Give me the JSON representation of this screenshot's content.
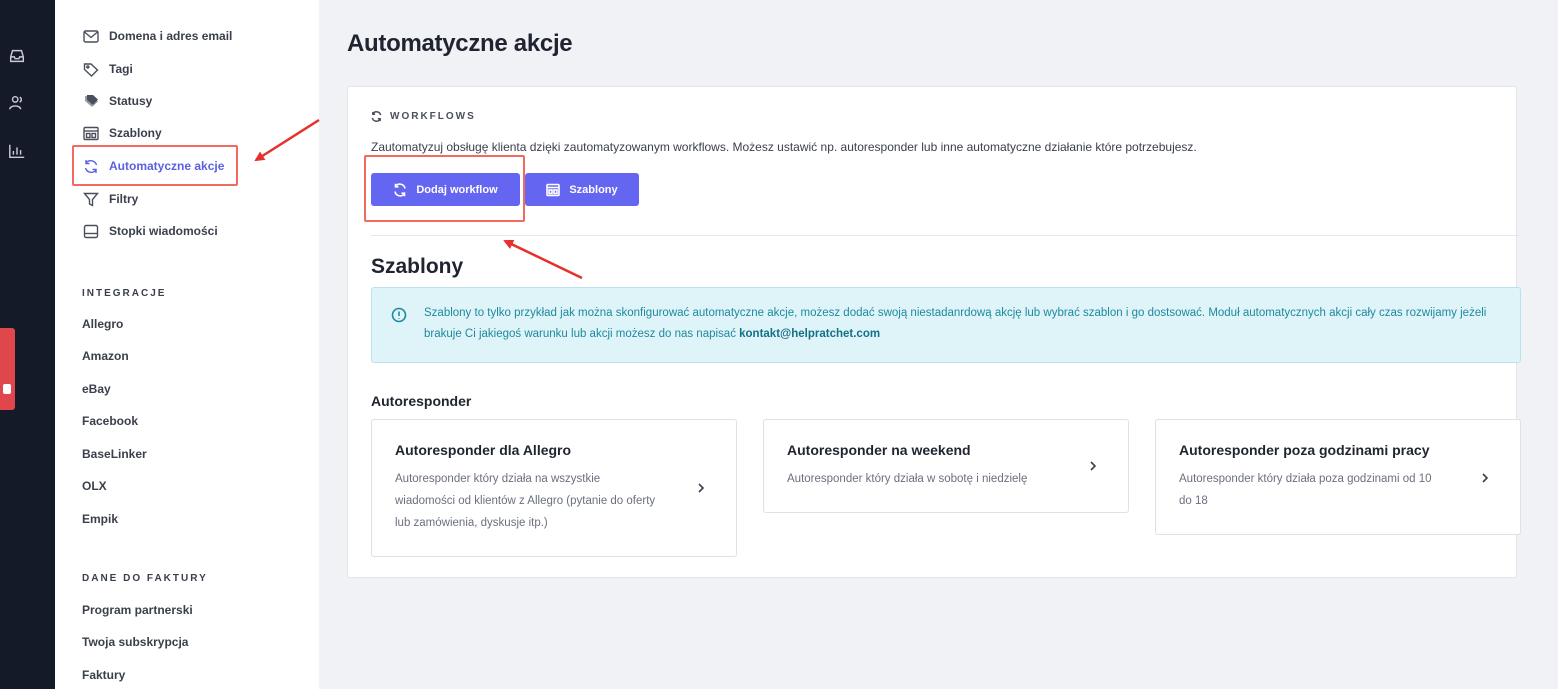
{
  "rail": {
    "icons": [
      "inbox-icon",
      "users-icon",
      "analytics-icon"
    ]
  },
  "sidebar": {
    "settings_items": [
      {
        "label": "Domena i adres email",
        "icon": "mail-icon"
      },
      {
        "label": "Tagi",
        "icon": "tag-icon"
      },
      {
        "label": "Statusy",
        "icon": "status-icon"
      },
      {
        "label": "Szablony",
        "icon": "template-icon"
      },
      {
        "label": "Automatyczne akcje",
        "icon": "refresh-icon",
        "active": true
      },
      {
        "label": "Filtry",
        "icon": "filter-icon"
      },
      {
        "label": "Stopki wiadomości",
        "icon": "footer-icon"
      }
    ],
    "integrations_label": "INTEGRACJE",
    "integrations": [
      "Allegro",
      "Amazon",
      "eBay",
      "Facebook",
      "BaseLinker",
      "OLX",
      "Empik"
    ],
    "billing_label": "DANE DO FAKTURY",
    "billing": [
      "Program partnerski",
      "Twoja subskrypcja",
      "Faktury"
    ]
  },
  "main": {
    "title": "Automatyczne akcje",
    "workflows_label": "WORKFLOWS",
    "workflows_desc": "Zautomatyzuj obsługę klienta dzięki zautomatyzowanym workflows. Możesz ustawić np. autoresponder lub inne automatyczne działanie które potrzebujesz.",
    "add_workflow_label": "Dodaj workflow",
    "templates_button_label": "Szablony",
    "templates_title": "Szablony",
    "info_text": "Szablony to tylko przykład jak można skonfigurować automatyczne akcje, możesz dodać swoją niestadanrdową akcję lub wybrać szablon i go dostsować. Moduł automatycznych akcji cały czas rozwijamy jeżeli brakuje Ci jakiegoś warunku lub akcji możesz do nas napisać",
    "info_email": "kontakt@helpratchet.com",
    "group_title": "Autoresponder",
    "templates": [
      {
        "title": "Autoresponder dla Allegro",
        "desc": "Autoresponder który działa na wszystkie wiadomości od klientów z Allegro (pytanie do oferty lub zamówienia, dyskusje itp.)"
      },
      {
        "title": "Autoresponder na weekend",
        "desc": "Autoresponder który działa w sobotę i niedzielę"
      },
      {
        "title": "Autoresponder poza godzinami pracy",
        "desc": "Autoresponder który działa poza godzinami od 10 do 18"
      }
    ]
  },
  "colors": {
    "accent": "#6466f1",
    "rail": "#151a28",
    "annotation": "#e8302a",
    "info_bg": "#dff4f8",
    "info_text": "#1d8a9e"
  }
}
